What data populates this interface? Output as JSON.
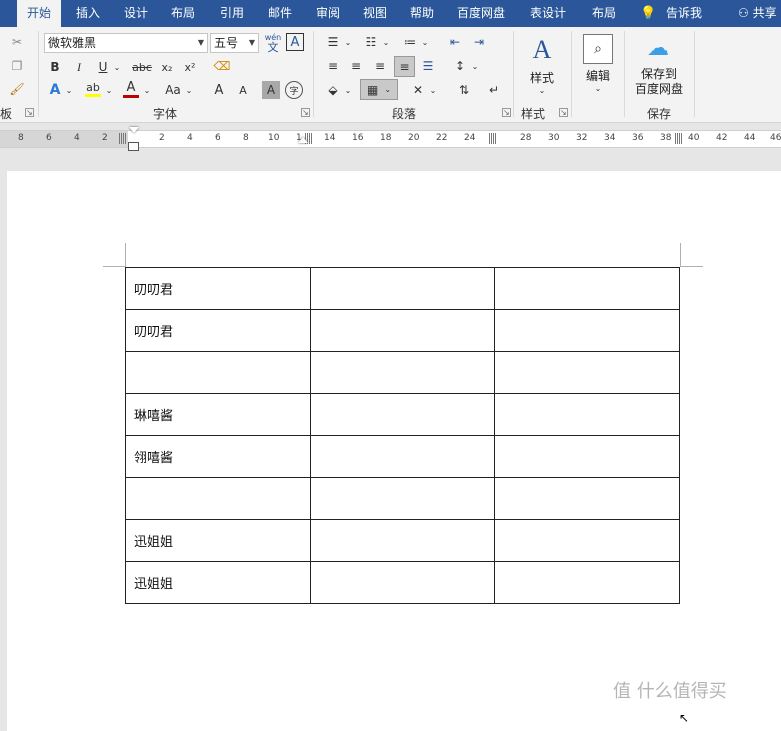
{
  "tabs": [
    "开始",
    "插入",
    "设计",
    "布局",
    "引用",
    "邮件",
    "审阅",
    "视图",
    "帮助",
    "百度网盘",
    "表设计",
    "布局",
    "告诉我",
    "共享"
  ],
  "active_tab": "开始",
  "font": {
    "name": "微软雅黑",
    "size": "五号",
    "phonetic_top": "wén",
    "phonetic_bottom": "文",
    "bold": "B",
    "italic": "I",
    "underline": "U",
    "strike": "abc",
    "subscript": "x₂",
    "superscript": "x²",
    "text_effect": "A",
    "highlight": "ab",
    "font_color": "A",
    "change_case": "Aa",
    "grow": "A",
    "shrink": "A",
    "char_shading": "A",
    "enclose": "字"
  },
  "groups": {
    "clipboard": "板",
    "font": "字体",
    "paragraph": "段落",
    "styles": "样式",
    "save": "保存"
  },
  "buttons": {
    "styles": "样式",
    "edit": "编辑",
    "save_to_baidu_line1": "保存到",
    "save_to_baidu_line2": "百度网盘"
  },
  "ruler": {
    "numbers": [
      "8",
      "6",
      "4",
      "2",
      "2",
      "4",
      "6",
      "8",
      "10",
      "1",
      "14",
      "16",
      "18",
      "20",
      "22",
      "24",
      "28",
      "30",
      "32",
      "34",
      "36",
      "38",
      "40",
      "42",
      "44",
      "46"
    ]
  },
  "table": {
    "rows": [
      [
        "叨叨君",
        "",
        ""
      ],
      [
        "叨叨君",
        "",
        ""
      ],
      [
        "",
        "",
        ""
      ],
      [
        "琳嘻酱",
        "",
        ""
      ],
      [
        "翎嘻酱",
        "",
        ""
      ],
      [
        "",
        "",
        ""
      ],
      [
        "迅姐姐",
        "",
        ""
      ],
      [
        "迅姐姐",
        "",
        ""
      ]
    ]
  },
  "watermark": "值 什么值得买",
  "colors": {
    "tab_bar": "#2b579a",
    "ribbon": "#f3f3f3",
    "font_color_bar": "#c00000",
    "highlight_bar": "#ffff00"
  }
}
